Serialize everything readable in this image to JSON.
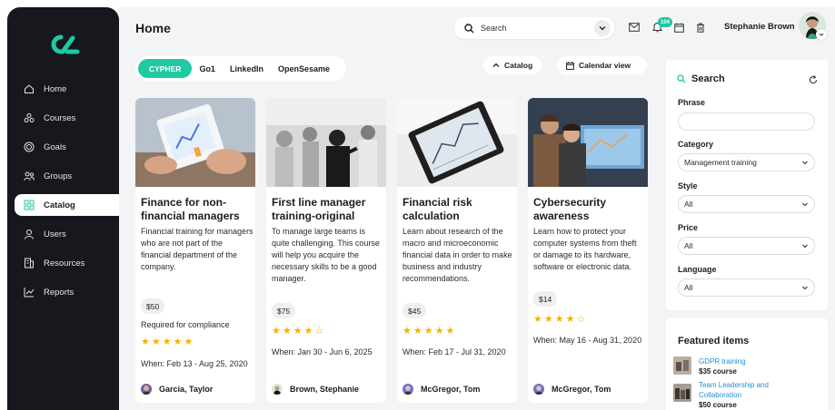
{
  "colors": {
    "accent": "#1fc9a3",
    "sidebar": "#16181d",
    "star": "#f3b400",
    "link": "#1e90d6"
  },
  "sidebar": {
    "logo": "logo-icon",
    "items": [
      {
        "label": "Home",
        "icon": "home-icon"
      },
      {
        "label": "Courses",
        "icon": "courses-icon"
      },
      {
        "label": "Goals",
        "icon": "goals-icon"
      },
      {
        "label": "Groups",
        "icon": "groups-icon"
      },
      {
        "label": "Catalog",
        "icon": "catalog-icon",
        "active": true
      },
      {
        "label": "Users",
        "icon": "users-icon"
      },
      {
        "label": "Resources",
        "icon": "resources-icon"
      },
      {
        "label": "Reports",
        "icon": "reports-icon"
      }
    ]
  },
  "header": {
    "title": "Home",
    "search_placeholder": "Search",
    "notification_count": "104",
    "user_name": "Stephanie Brown"
  },
  "providers": [
    {
      "label": "CYPHER",
      "active": true
    },
    {
      "label": "Go1"
    },
    {
      "label": "LinkedIn"
    },
    {
      "label": "OpenSesame"
    }
  ],
  "toolbar": {
    "catalog_label": "Catalog",
    "calendar_label": "Calendar view"
  },
  "cards": [
    {
      "title": "Finance for non-financial managers",
      "description": "Financial training for managers who are not part of the financial department of the company.",
      "price": "$50",
      "note": "Required for compliance",
      "rating": 4.5,
      "when": "When: Feb 13 - Aug 25, 2020",
      "author": "Garcia, Taylor"
    },
    {
      "title": "First line manager training-original",
      "description": "To manage large teams is quite challenging. This course will help you acquire the necessary skills to be a good manager.",
      "price": "$75",
      "note": "",
      "rating": 4,
      "when": "When: Jan 30 - Jun 6, 2025",
      "author": "Brown, Stephanie"
    },
    {
      "title": "Financial risk calculation",
      "description": "Learn about research of the macro and microeconomic financial data in order to make business and industry recommendations.",
      "price": "$45",
      "note": "",
      "rating": 5,
      "when": "When: Feb 17 - Jul 31, 2020",
      "author": "McGregor, Tom"
    },
    {
      "title": "Cybersecurity awareness",
      "description": "Learn how to protect your computer systems from theft or damage to its hardware, software or electronic data.",
      "price": "$14",
      "note": "",
      "rating": 4,
      "when": "When: May 16 - Aug 31, 2020",
      "author": "McGregor, Tom"
    }
  ],
  "filters": {
    "heading": "Search",
    "phrase_label": "Phrase",
    "phrase_value": "",
    "category_label": "Category",
    "category_value": "Management training",
    "style_label": "Style",
    "style_value": "All",
    "price_label": "Price",
    "price_value": "All",
    "language_label": "Language",
    "language_value": "All"
  },
  "featured": {
    "heading": "Featured items",
    "items": [
      {
        "title": "GDPR training",
        "price": "$35 course"
      },
      {
        "title": "Team Leadership and Collaboration",
        "price": "$50 course"
      }
    ]
  }
}
